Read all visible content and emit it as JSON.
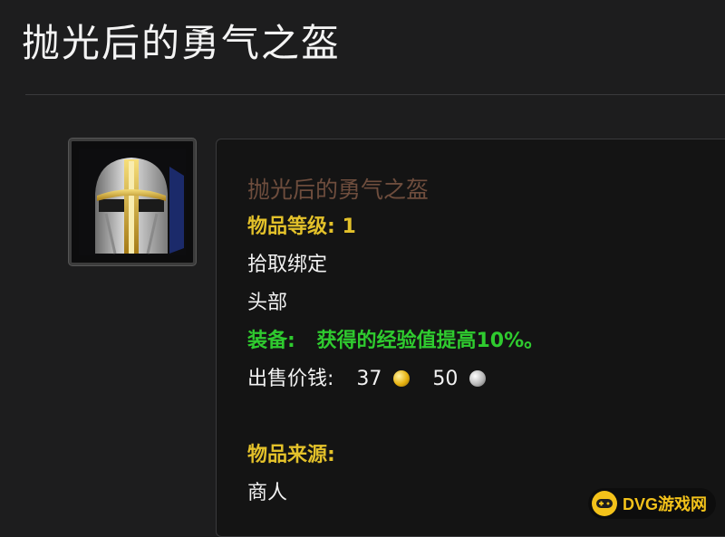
{
  "page": {
    "title": "抛光后的勇气之盔"
  },
  "item": {
    "name": "抛光后的勇气之盔",
    "level_label": "物品等级:",
    "level_value": "1",
    "binding": "拾取绑定",
    "slot": "头部",
    "equip_label": "装备:",
    "equip_text": "获得的经验值提高10%。",
    "sell_label": "出售价钱:",
    "sell_gold": "37",
    "sell_silver": "50",
    "source_label": "物品来源:",
    "source_value": "商人",
    "icon": "helmet-icon"
  },
  "watermark": {
    "text": "DVG游戏网",
    "icon": "gamepad-icon"
  },
  "colors": {
    "background": "#1d1d1e",
    "item_name": "#6e4d3d",
    "gold_label": "#e3c12a",
    "equip_green": "#2fcb2f"
  }
}
